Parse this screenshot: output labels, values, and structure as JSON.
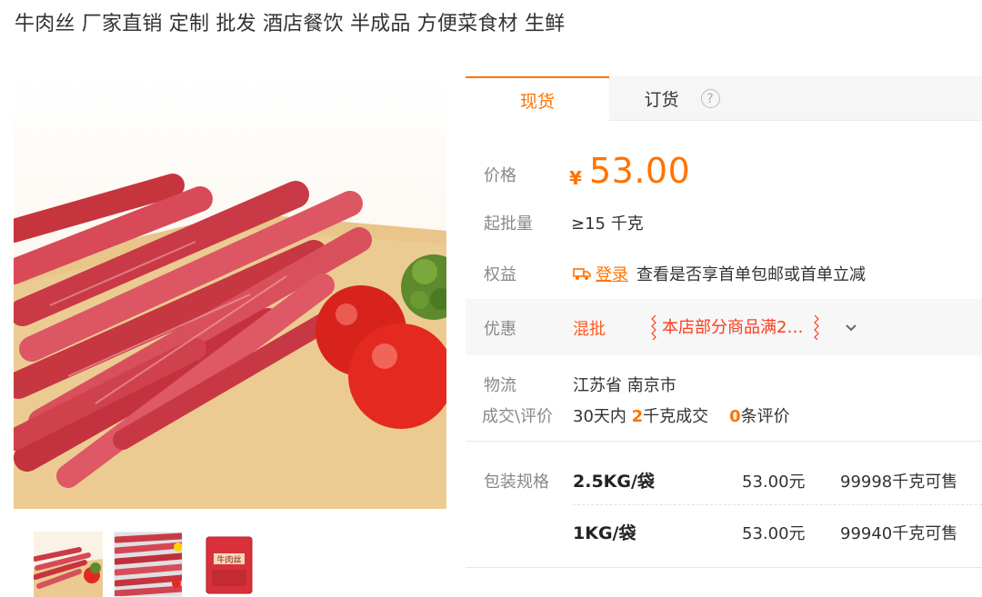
{
  "product": {
    "title": "牛肉丝 厂家直销 定制 批发 酒店餐饮 半成品 方便菜食材 生鲜"
  },
  "tabs": {
    "in_stock": "现货",
    "preorder": "订货",
    "help_glyph": "?"
  },
  "price": {
    "label": "价格",
    "currency": "¥",
    "value": "53.00",
    "accent_color": "#ff7300"
  },
  "min_order": {
    "label": "起批量",
    "value": "≥15 千克"
  },
  "benefits": {
    "label": "权益",
    "login_link": "登录",
    "text": "查看是否享首单包邮或首单立减"
  },
  "promotion": {
    "label": "优惠",
    "tag": "混批",
    "coupon_text": "本店部分商品满2…"
  },
  "logistics": {
    "label": "物流",
    "location": "江苏省 南京市"
  },
  "deals": {
    "label": "成交\\评价",
    "prefix": "30天内",
    "count": "2",
    "unit_text": "千克成交",
    "review_count": "0",
    "review_text": "条评价"
  },
  "specs": {
    "label": "包装规格",
    "rows": [
      {
        "name": "2.5KG/袋",
        "price": "53.00元",
        "stock": "99998千克可售"
      },
      {
        "name": "1KG/袋",
        "price": "53.00元",
        "stock": "99940千克可售"
      }
    ]
  },
  "thumb3_label": "牛肉丝"
}
